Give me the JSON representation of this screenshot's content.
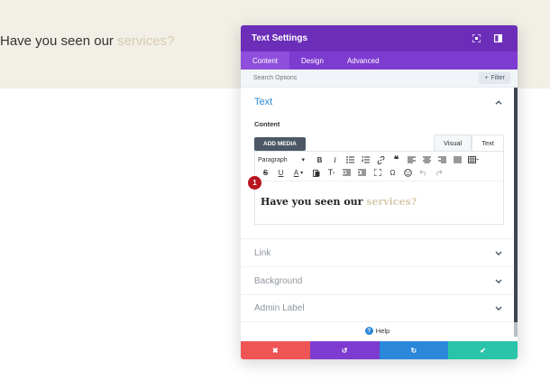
{
  "hero": {
    "text_main": "Have you seen our ",
    "text_accent": "services?"
  },
  "modal": {
    "title": "Text Settings",
    "header_icons": [
      "expand-icon",
      "sidebar-icon"
    ],
    "tabs": [
      {
        "label": "Content",
        "active": true
      },
      {
        "label": "Design",
        "active": false
      },
      {
        "label": "Advanced",
        "active": false
      }
    ],
    "search": {
      "placeholder": "Search Options"
    },
    "filter_label": "Filter",
    "text_section": {
      "title": "Text",
      "field_label": "Content",
      "add_media_label": "ADD MEDIA",
      "editor_tabs": [
        {
          "label": "Visual",
          "active": false
        },
        {
          "label": "Text",
          "active": true
        }
      ],
      "toolbar_select": "Paragraph",
      "content_main": "Have you seen our ",
      "content_accent": "services?",
      "badge_number": "1"
    },
    "collapsed_sections": [
      {
        "title": "Link"
      },
      {
        "title": "Background"
      },
      {
        "title": "Admin Label"
      }
    ],
    "help_label": "Help",
    "footer_buttons": [
      {
        "name": "discard-button",
        "glyph": "✖",
        "color": "#ef5555"
      },
      {
        "name": "undo-button",
        "glyph": "↺",
        "color": "#7e3bd0"
      },
      {
        "name": "redo-button",
        "glyph": "↻",
        "color": "#2b87da"
      },
      {
        "name": "save-button",
        "glyph": "✔",
        "color": "#29c4a9"
      }
    ]
  },
  "colors": {
    "header": "#6c2eb9",
    "tabs": "#7e3bd0",
    "accent_blue": "#2e8bd8",
    "accent_text": "#d9ccb0",
    "hero_band": "#f1efe6"
  }
}
